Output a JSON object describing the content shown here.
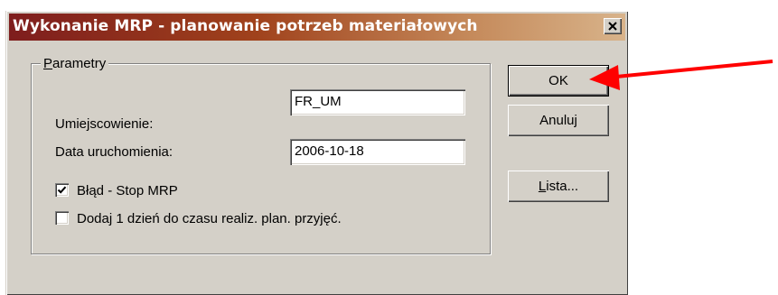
{
  "window": {
    "title": "Wykonanie MRP - planowanie potrzeb materiałowych",
    "close_label": "×"
  },
  "group": {
    "label": "Parametry"
  },
  "fields": {
    "location_label": "Umiejscowienie:",
    "location_value": "FR_UM",
    "run_date_label": "Data uruchomienia:",
    "run_date_value": "2006-10-18"
  },
  "checkboxes": [
    {
      "label": "Błąd - Stop MRP",
      "checked": true
    },
    {
      "label": "Dodaj 1 dzień do czasu realiz. plan. przyjęć.",
      "checked": false
    }
  ],
  "buttons": {
    "ok_label": "OK",
    "cancel_label": "Anuluj",
    "list_label": "Lista..."
  },
  "annotation": {
    "icon": "red-arrow",
    "color": "#ff0000"
  }
}
